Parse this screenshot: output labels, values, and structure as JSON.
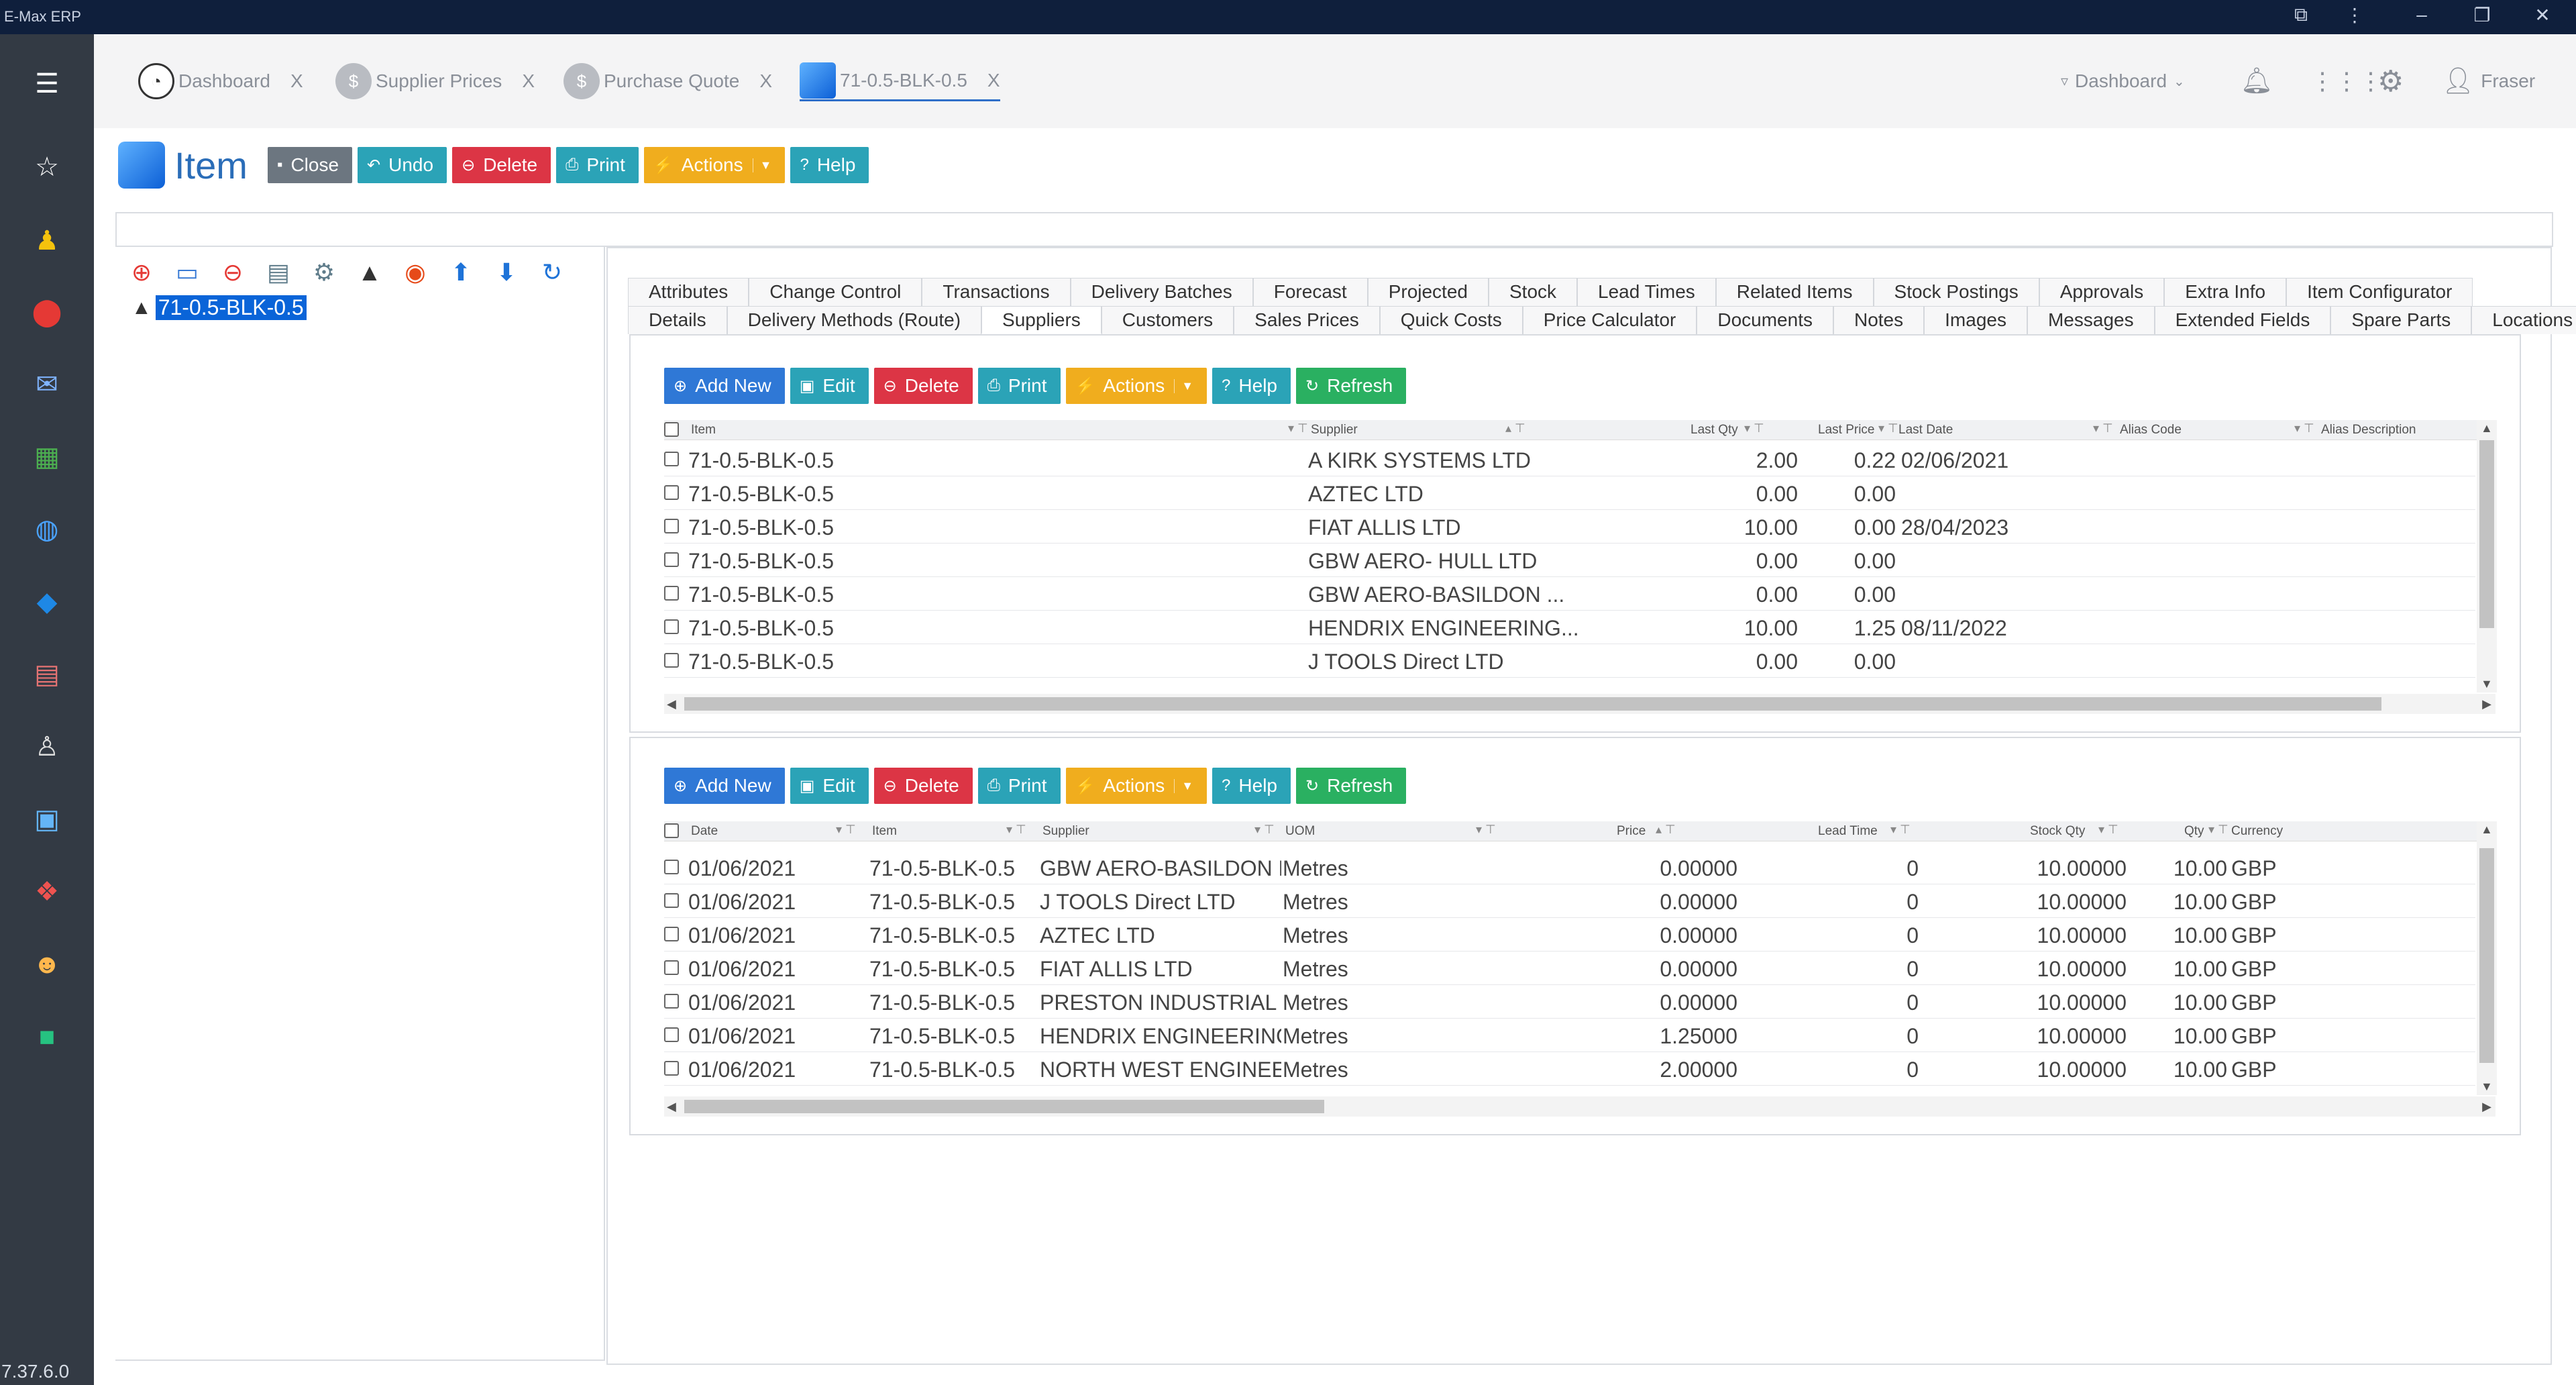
{
  "app": {
    "title": "E-Max ERP",
    "version": "7.37.6.0"
  },
  "tabs": [
    {
      "label": "Dashboard",
      "close": "X"
    },
    {
      "label": "Supplier Prices",
      "close": "X"
    },
    {
      "label": "Purchase Quote",
      "close": "X"
    },
    {
      "label": "71-0.5-BLK-0.5",
      "close": "X"
    }
  ],
  "topright": {
    "dashboard": "Dashboard",
    "user": "Fraser"
  },
  "page": {
    "title": "Item",
    "buttons": {
      "close": "Close",
      "undo": "Undo",
      "delete": "Delete",
      "print": "Print",
      "actions": "Actions",
      "help": "Help"
    }
  },
  "tree": {
    "item": "71-0.5-BLK-0.5"
  },
  "detail_tabs": {
    "row1": [
      "Attributes",
      "Change Control",
      "Transactions",
      "Delivery Batches",
      "Forecast",
      "Projected",
      "Stock",
      "Lead Times",
      "Related Items",
      "Stock Postings",
      "Approvals",
      "Extra Info",
      "Item Configurator"
    ],
    "row2": [
      "Details",
      "Delivery Methods (Route)",
      "Suppliers",
      "Customers",
      "Sales Prices",
      "Quick Costs",
      "Price Calculator",
      "Documents",
      "Notes",
      "Images",
      "Messages",
      "Extended Fields",
      "Spare Parts",
      "Locations"
    ],
    "active": "Suppliers"
  },
  "grid_buttons": {
    "add": "Add New",
    "edit": "Edit",
    "delete": "Delete",
    "print": "Print",
    "actions": "Actions",
    "help": "Help",
    "refresh": "Refresh"
  },
  "suppliers_grid": {
    "headers": [
      "Item",
      "Supplier",
      "Last Qty",
      "Last Price",
      "Last Date",
      "Alias Code",
      "Alias Description"
    ],
    "rows": [
      [
        "71-0.5-BLK-0.5",
        "A KIRK SYSTEMS LTD",
        "2.00",
        "0.22",
        "02/06/2021"
      ],
      [
        "71-0.5-BLK-0.5",
        "AZTEC LTD",
        "0.00",
        "0.00",
        ""
      ],
      [
        "71-0.5-BLK-0.5",
        "FIAT ALLIS LTD",
        "10.00",
        "0.00",
        "28/04/2023"
      ],
      [
        "71-0.5-BLK-0.5",
        "GBW AERO- HULL LTD",
        "0.00",
        "0.00",
        ""
      ],
      [
        "71-0.5-BLK-0.5",
        "GBW AERO-BASILDON ...",
        "0.00",
        "0.00",
        ""
      ],
      [
        "71-0.5-BLK-0.5",
        "HENDRIX ENGINEERING...",
        "10.00",
        "1.25",
        "08/11/2022"
      ],
      [
        "71-0.5-BLK-0.5",
        "J TOOLS Direct LTD",
        "0.00",
        "0.00",
        ""
      ]
    ]
  },
  "prices_grid": {
    "headers": [
      "Date",
      "Item",
      "Supplier",
      "UOM",
      "Price",
      "Lead Time",
      "Stock Qty",
      "Qty",
      "Currency"
    ],
    "rows": [
      [
        "01/06/2021",
        "71-0.5-BLK-0.5",
        "GBW AERO-BASILDON L...",
        "Metres",
        "0.00000",
        "0",
        "10.00000",
        "10.00",
        "GBP"
      ],
      [
        "01/06/2021",
        "71-0.5-BLK-0.5",
        "J TOOLS Direct LTD",
        "Metres",
        "0.00000",
        "0",
        "10.00000",
        "10.00",
        "GBP"
      ],
      [
        "01/06/2021",
        "71-0.5-BLK-0.5",
        "AZTEC LTD",
        "Metres",
        "0.00000",
        "0",
        "10.00000",
        "10.00",
        "GBP"
      ],
      [
        "01/06/2021",
        "71-0.5-BLK-0.5",
        "FIAT ALLIS LTD",
        "Metres",
        "0.00000",
        "0",
        "10.00000",
        "10.00",
        "GBP"
      ],
      [
        "01/06/2021",
        "71-0.5-BLK-0.5",
        "PRESTON INDUSTRIAL P...",
        "Metres",
        "0.00000",
        "0",
        "10.00000",
        "10.00",
        "GBP"
      ],
      [
        "01/06/2021",
        "71-0.5-BLK-0.5",
        "HENDRIX ENGINEERING ...",
        "Metres",
        "1.25000",
        "0",
        "10.00000",
        "10.00",
        "GBP"
      ],
      [
        "01/06/2021",
        "71-0.5-BLK-0.5",
        "NORTH WEST ENGINEE...",
        "Metres",
        "2.00000",
        "0",
        "10.00000",
        "10.00",
        "GBP"
      ]
    ]
  },
  "colors": {
    "titlebar": "#0f1f3c",
    "sidebar": "#333a44",
    "accent": "#2f78d6",
    "selection": "#0a64d8"
  }
}
